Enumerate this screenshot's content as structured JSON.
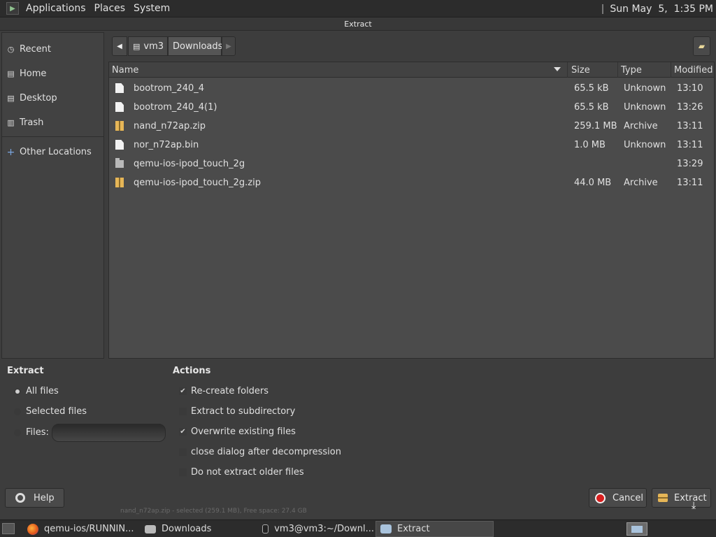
{
  "top_panel": {
    "menus": [
      "Applications",
      "Places",
      "System"
    ],
    "clock": "Sun May  5,  1:35 PM"
  },
  "window": {
    "title": "Extract"
  },
  "sidebar": {
    "items": [
      {
        "label": "Recent",
        "icon": "clock-icon"
      },
      {
        "label": "Home",
        "icon": "home-folder-icon"
      },
      {
        "label": "Desktop",
        "icon": "desktop-folder-icon"
      },
      {
        "label": "Trash",
        "icon": "trash-icon"
      }
    ],
    "other": {
      "label": "Other Locations",
      "icon": "plus-icon"
    }
  },
  "pathbar": {
    "segments": [
      "vm3",
      "Downloads"
    ],
    "active": "Downloads"
  },
  "filelist": {
    "columns": {
      "name": "Name",
      "size": "Size",
      "type": "Type",
      "modified": "Modified"
    },
    "sorted_by": "Name",
    "rows": [
      {
        "icon": "file",
        "name": "bootrom_240_4",
        "size": "65.5 kB",
        "type": "Unknown",
        "modified": "13:10"
      },
      {
        "icon": "file",
        "name": "bootrom_240_4(1)",
        "size": "65.5 kB",
        "type": "Unknown",
        "modified": "13:26"
      },
      {
        "icon": "archive",
        "name": "nand_n72ap.zip",
        "size": "259.1 MB",
        "type": "Archive",
        "modified": "13:11"
      },
      {
        "icon": "file",
        "name": "nor_n72ap.bin",
        "size": "1.0 MB",
        "type": "Unknown",
        "modified": "13:11"
      },
      {
        "icon": "folder",
        "name": "qemu-ios-ipod_touch_2g",
        "size": "",
        "type": "",
        "modified": "13:29"
      },
      {
        "icon": "archive",
        "name": "qemu-ios-ipod_touch_2g.zip",
        "size": "44.0 MB",
        "type": "Archive",
        "modified": "13:11"
      }
    ]
  },
  "extract_options": {
    "heading": "Extract",
    "all_files": "All files",
    "selected_files": "Selected files",
    "files_label": "Files:",
    "files_value": "",
    "selected": "All files"
  },
  "actions": {
    "heading": "Actions",
    "recreate_folders": {
      "label": "Re-create folders",
      "checked": true
    },
    "extract_to_subdir": {
      "label": "Extract to subdirectory",
      "checked": false
    },
    "overwrite": {
      "label": "Overwrite existing files",
      "checked": true
    },
    "close_after": {
      "label": "close dialog after decompression",
      "checked": false
    },
    "no_older": {
      "label": "Do not extract older files",
      "checked": false
    }
  },
  "buttons": {
    "help": "Help",
    "cancel": "Cancel",
    "extract": "Extract"
  },
  "statusbar": {
    "text": "nand_n72ap.zip - selected (259.1 MB), Free space: 27.4 GB"
  },
  "taskbar": {
    "items": [
      {
        "label": "qemu-ios/RUNNIN...",
        "icon": "firefox-icon"
      },
      {
        "label": "Downloads",
        "icon": "folder-icon"
      },
      {
        "label": "vm3@vm3:~/Downl...",
        "icon": "terminal-icon"
      },
      {
        "label": "Extract",
        "icon": "archive-manager-icon",
        "active": true
      }
    ]
  }
}
